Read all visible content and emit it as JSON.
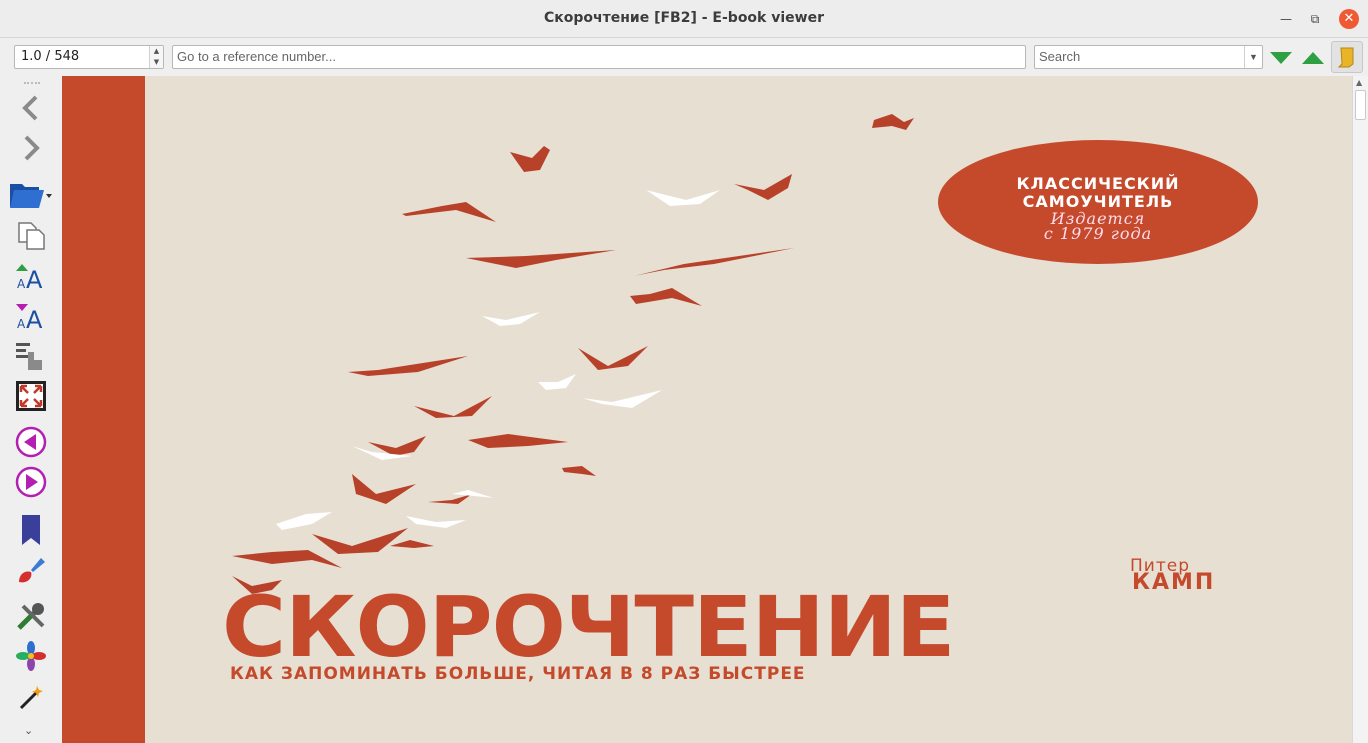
{
  "window": {
    "title": "Скорочтение [FB2] - E-book viewer"
  },
  "toolbar": {
    "position_value": "1.0 / 548",
    "reference_placeholder": "Go to a reference number...",
    "search_placeholder": "Search"
  },
  "book": {
    "badge_line1": "КЛАССИЧЕСКИЙ",
    "badge_line2": "САМОУЧИТЕЛЬ",
    "badge_line3": "Издается",
    "badge_line4": "с 1979 года",
    "author_first": "Питер",
    "author_last": "КАМП",
    "title": "СКОРОЧТЕНИЕ",
    "subtitle": "КАК ЗАПОМИНАТЬ БОЛЬШЕ, ЧИТАЯ В 8 РАЗ БЫСТРЕЕ"
  },
  "colors": {
    "cover_red": "#c54a2c",
    "cover_bg": "#e6dfd2",
    "accent_green": "#2ea043",
    "accent_purple": "#b31fb0"
  }
}
